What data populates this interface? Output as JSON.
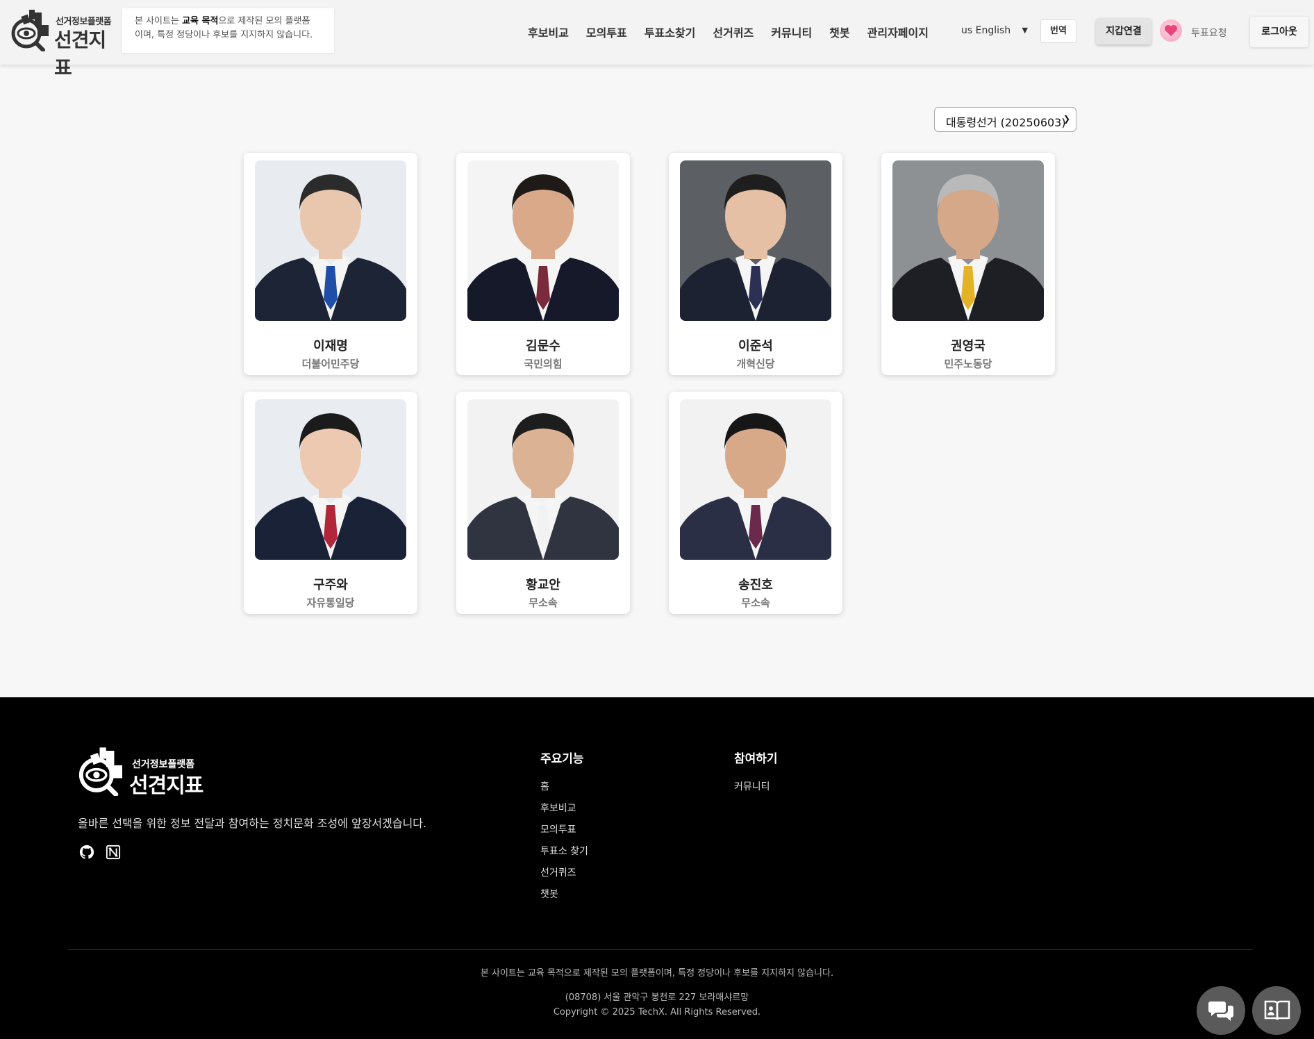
{
  "header": {
    "logo_small": "선거정보플랫폼",
    "logo_big": "선견지표",
    "notice_prefix": "본 사이트는 ",
    "notice_bold": "교육 목적",
    "notice_suffix": "으로 제작된 모의 플랫폼",
    "notice_line2": "이며, 특정 정당이나 후보를 지지하지 않습니다.",
    "nav": [
      "후보비교",
      "모의투표",
      "투표소찾기",
      "선거퀴즈",
      "커뮤니티",
      "챗봇",
      "관리자페이지"
    ],
    "language": "us English",
    "translate_label": "번역",
    "wallet_label": "지갑연결",
    "vote_request_label": "투표요청",
    "logout_label": "로그아웃"
  },
  "election_select": {
    "selected": "대통령선거 (20250603)"
  },
  "candidates": [
    {
      "name": "이재명",
      "party": "더불어민주당",
      "tie_color": "#1f4ea8",
      "bg": "#e8ebf0"
    },
    {
      "name": "김문수",
      "party": "국민의힘",
      "tie_color": "#7a2a3a",
      "bg": "#f4f4f4"
    },
    {
      "name": "이준석",
      "party": "개혁신당",
      "tie_color": "#2d2f55",
      "bg": "#5c5f63"
    },
    {
      "name": "권영국",
      "party": "민주노동당",
      "tie_color": "#e3b225",
      "bg": "#8d9194"
    },
    {
      "name": "구주와",
      "party": "자유통일당",
      "tie_color": "#b3263a",
      "bg": "#e9ecf1"
    },
    {
      "name": "황교안",
      "party": "무소속",
      "tie_color": "#f2f2f2",
      "bg": "#f2f2f2"
    },
    {
      "name": "송진호",
      "party": "무소속",
      "tie_color": "#6b2a4c",
      "bg": "#f2f2f2"
    }
  ],
  "footer": {
    "logo_small": "선거정보플랫폼",
    "logo_big": "선견지표",
    "description": "올바른 선택을 위한 정보 전달과 참여하는 정치문화 조성에 앞장서겠습니다.",
    "col1_title": "주요기능",
    "col1_links": [
      "홈",
      "후보비교",
      "모의투표",
      "투표소 찾기",
      "선거퀴즈",
      "챗봇"
    ],
    "col2_title": "참여하기",
    "col2_links": [
      "커뮤니티"
    ],
    "disclaimer": "본 사이트는 교육 목적으로 제작된 모의 플랫폼이며, 특정 정당이나 후보를 지지하지 않습니다.",
    "address": "(08708) 서울 관악구 봉천로 227 보라매샤르망",
    "copyright": "Copyright © 2025 TechX. All Rights Reserved."
  }
}
